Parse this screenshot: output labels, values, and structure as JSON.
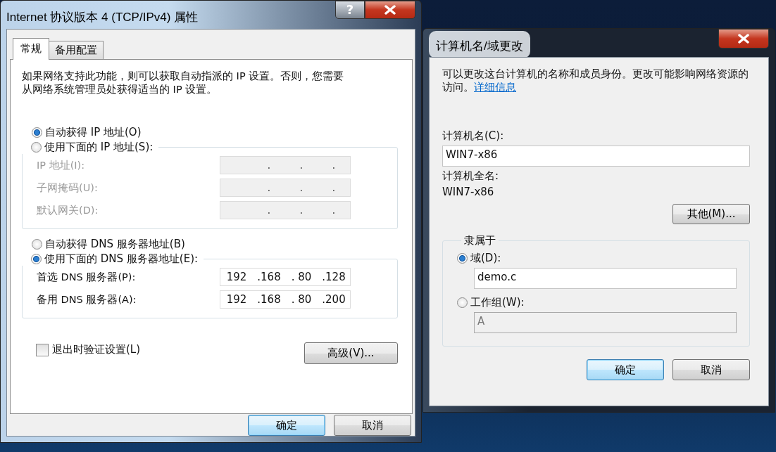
{
  "ipv4_dialog": {
    "title": "Internet 协议版本 4 (TCP/IPv4) 属性",
    "help_button": "?",
    "tabs": [
      {
        "label": "常规",
        "selected": true
      },
      {
        "label": "备用配置",
        "selected": false
      }
    ],
    "description": "如果网络支持此功能，则可以获取自动指派的 IP 设置。否则，您需要从网络系统管理员处获得适当的 IP 设置。",
    "ip_options": [
      {
        "label": "自动获得 IP 地址(O)",
        "selected": true
      },
      {
        "label": "使用下面的 IP 地址(S):",
        "selected": false
      }
    ],
    "ip_fields": [
      {
        "label": "IP 地址(I):",
        "disabled": true,
        "parts": [
          ".",
          ".",
          "."
        ]
      },
      {
        "label": "子网掩码(U):",
        "disabled": true,
        "parts": [
          ".",
          ".",
          "."
        ]
      },
      {
        "label": "默认网关(D):",
        "disabled": true,
        "parts": [
          ".",
          ".",
          "."
        ]
      }
    ],
    "dns_options": [
      {
        "label": "自动获得 DNS 服务器地址(B)",
        "selected": false
      },
      {
        "label": "使用下面的 DNS 服务器地址(E):",
        "selected": true
      }
    ],
    "dns_fields": [
      {
        "label": "首选 DNS 服务器(P):",
        "disabled": false,
        "parts": [
          "192",
          ".168",
          ". 80",
          ".128"
        ]
      },
      {
        "label": "备用 DNS 服务器(A):",
        "disabled": false,
        "parts": [
          "192",
          ".168",
          ". 80",
          ".200"
        ]
      }
    ],
    "validate_checkbox": {
      "label": "退出时验证设置(L)",
      "checked": false
    },
    "advanced_button": "高级(V)...",
    "buttons": [
      {
        "label": "确定",
        "default": true
      },
      {
        "label": "取消",
        "default": false
      }
    ]
  },
  "computer_name_dialog": {
    "title": "计算机名/域更改",
    "description": "可以更改这台计算机的名称和成员身份。更改可能影响网络资源的访问。",
    "details_link": "详细信息",
    "computer_name_label": "计算机名(C):",
    "computer_name_value": "WIN7-x86",
    "full_name_label": "计算机全名:",
    "full_name_value": "WIN7-x86",
    "other_button": "其他(M)...",
    "member_of": {
      "title": "隶属于",
      "options": [
        {
          "label": "域(D):",
          "selected": true,
          "value": "demo.c",
          "disabled": false
        },
        {
          "label": "工作组(W):",
          "selected": false,
          "value": "A",
          "disabled": true
        }
      ]
    },
    "buttons": [
      {
        "label": "确定",
        "default": true
      },
      {
        "label": "取消",
        "default": false
      }
    ]
  }
}
